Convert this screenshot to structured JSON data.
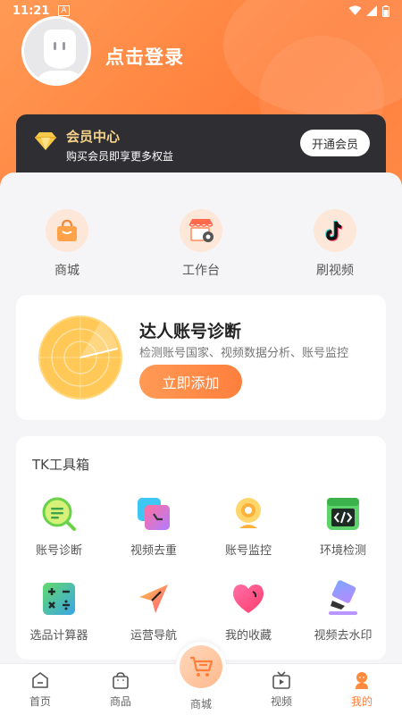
{
  "status_bar": {
    "time": "11:21",
    "notif": "A"
  },
  "profile": {
    "login_text": "点击登录"
  },
  "member": {
    "title": "会员中心",
    "subtitle": "购买会员即享更多权益",
    "button": "开通会员"
  },
  "quick_actions": [
    {
      "label": "商城",
      "icon": "shopping-bag-icon"
    },
    {
      "label": "工作台",
      "icon": "storefront-icon"
    },
    {
      "label": "刷视频",
      "icon": "tiktok-icon"
    }
  ],
  "diagnosis": {
    "title": "达人账号诊断",
    "subtitle": "检测账号国家、视频数据分析、账号监控",
    "button": "立即添加"
  },
  "toolbox": {
    "title": "TK工具箱",
    "tools": [
      {
        "label": "账号诊断",
        "icon": "magnifier-report-icon"
      },
      {
        "label": "视频去重",
        "icon": "video-stack-icon"
      },
      {
        "label": "账号监控",
        "icon": "webcam-icon"
      },
      {
        "label": "环境检测",
        "icon": "code-window-icon"
      },
      {
        "label": "选品计算器",
        "icon": "calculator-icon"
      },
      {
        "label": "运营导航",
        "icon": "navigation-arrow-icon"
      },
      {
        "label": "我的收藏",
        "icon": "heart-icon"
      },
      {
        "label": "视频去水印",
        "icon": "eraser-icon"
      }
    ]
  },
  "bottom_nav": {
    "items": [
      {
        "label": "首页",
        "icon": "home-icon"
      },
      {
        "label": "商品",
        "icon": "bag-icon"
      },
      {
        "label": "商城",
        "icon": "cart-icon"
      },
      {
        "label": "视频",
        "icon": "tv-icon"
      },
      {
        "label": "我的",
        "icon": "person-icon"
      }
    ],
    "active": "我的"
  },
  "colors": {
    "accent": "#ff7e3a",
    "member_gold": "#f7d38a",
    "card_dark": "#2f2f33"
  }
}
